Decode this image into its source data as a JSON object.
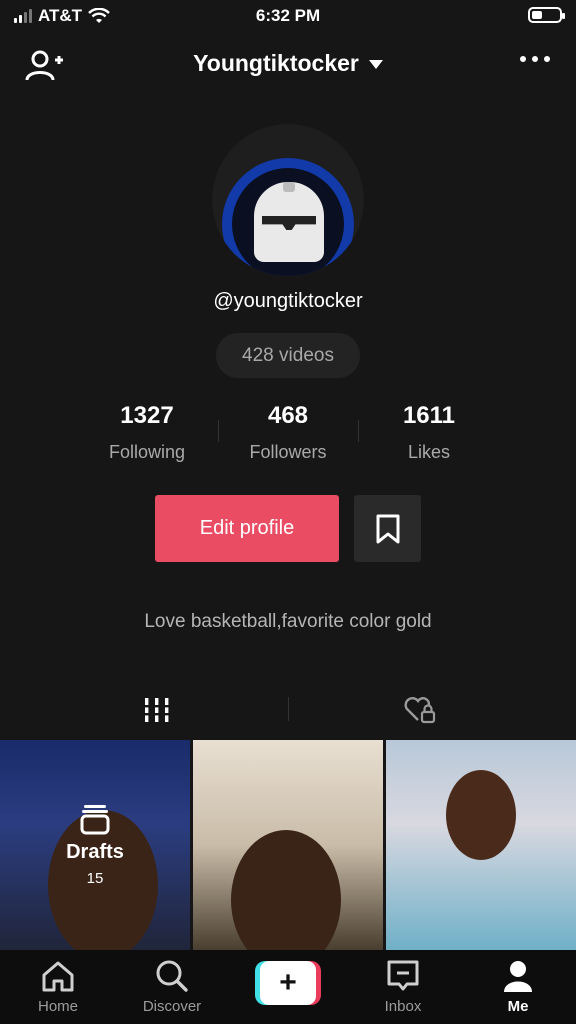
{
  "status_bar": {
    "carrier": "AT&T",
    "time": "6:32 PM"
  },
  "header": {
    "title": "Youngtiktocker",
    "add_user_icon": "person-add-icon",
    "more_icon": "ellipsis-icon"
  },
  "profile": {
    "username": "@youngtiktocker",
    "video_count": "428 videos",
    "stats": [
      {
        "value": "1327",
        "label": "Following"
      },
      {
        "value": "468",
        "label": "Followers"
      },
      {
        "value": "1611",
        "label": "Likes"
      }
    ],
    "edit_button": "Edit profile",
    "bio": "Love basketball,favorite color gold"
  },
  "drafts": {
    "label": "Drafts",
    "count": "15"
  },
  "nav": [
    {
      "label": "Home",
      "icon": "home-icon"
    },
    {
      "label": "Discover",
      "icon": "search-icon"
    },
    {
      "label": "",
      "icon": "plus-icon"
    },
    {
      "label": "Inbox",
      "icon": "inbox-icon"
    },
    {
      "label": "Me",
      "icon": "person-icon"
    }
  ],
  "colors": {
    "accent": "#ea4c63",
    "background": "#161616"
  }
}
